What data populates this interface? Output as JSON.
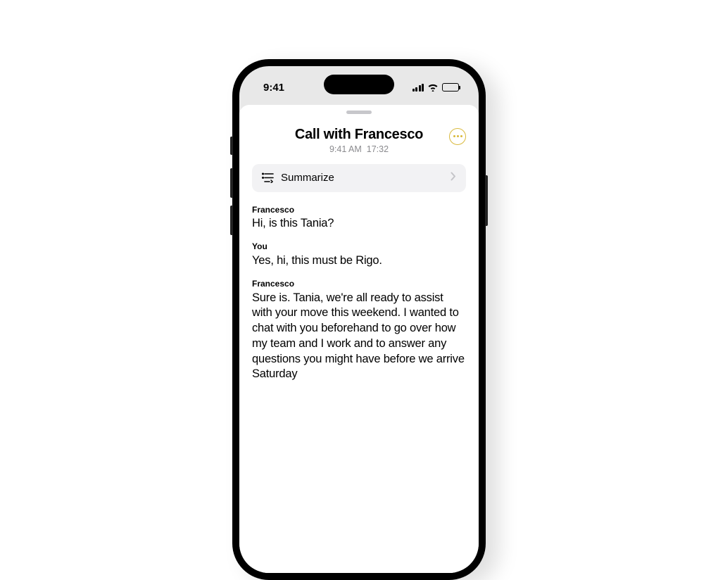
{
  "status": {
    "time": "9:41"
  },
  "header": {
    "title": "Call with Francesco",
    "timestamp": "9:41 AM",
    "duration": "17:32"
  },
  "summarize": {
    "label": "Summarize"
  },
  "transcript": [
    {
      "speaker": "Francesco",
      "text": "Hi, is this Tania?"
    },
    {
      "speaker": "You",
      "text": "Yes, hi, this must be Rigo."
    },
    {
      "speaker": "Francesco",
      "text": "Sure is. Tania, we're all ready to assist with your move this weekend. I wanted to chat with you beforehand to go over how my team and I work and to answer any questions you might have before we arrive Saturday"
    }
  ]
}
